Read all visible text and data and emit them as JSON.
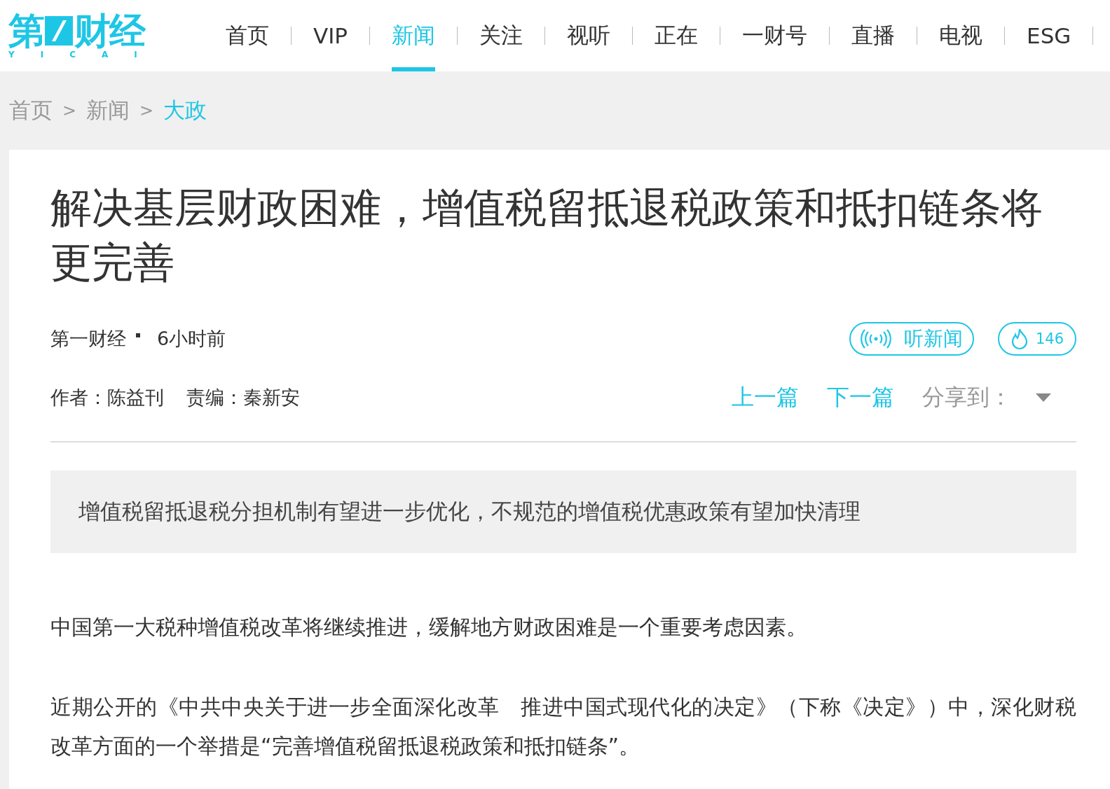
{
  "logo": {
    "first": "第",
    "rest": "财经",
    "latin": "YICAI"
  },
  "nav": [
    {
      "label": "首页",
      "selected": false
    },
    {
      "label": "VIP",
      "selected": false
    },
    {
      "label": "新闻",
      "selected": true
    },
    {
      "label": "关注",
      "selected": false
    },
    {
      "label": "视听",
      "selected": false
    },
    {
      "label": "正在",
      "selected": false
    },
    {
      "label": "一财号",
      "selected": false
    },
    {
      "label": "直播",
      "selected": false
    },
    {
      "label": "电视",
      "selected": false
    },
    {
      "label": "ESG",
      "selected": false
    }
  ],
  "breadcrumb": [
    {
      "label": "首页",
      "selected": false
    },
    {
      "label": "新闻",
      "selected": false
    },
    {
      "label": "大政",
      "selected": true
    }
  ],
  "breadcrumb_separator": ">",
  "article": {
    "title": "解决基层财政困难，增值税留抵退税政策和抵扣链条将更完善",
    "source": "第一财经",
    "time": "6小时前",
    "listen_button": "听新闻",
    "heat": "146",
    "author": "作者：陈益刊",
    "editor": "责编：秦新安",
    "prev": "上一篇",
    "next": "下一篇",
    "share": "分享到：",
    "summary": "增值税留抵退税分担机制有望进一步优化，不规范的增值税优惠政策有望加快清理",
    "paragraphs": [
      "中国第一大税种增值税改革将继续推进，缓解地方财政困难是一个重要考虑因素。",
      "近期公开的《中共中央关于进一步全面深化改革　推进中国式现代化的决定》（下称《决定》）中，深化财税改革方面的一个举措是“完善增值税留抵退税政策和抵扣链条”。"
    ]
  }
}
